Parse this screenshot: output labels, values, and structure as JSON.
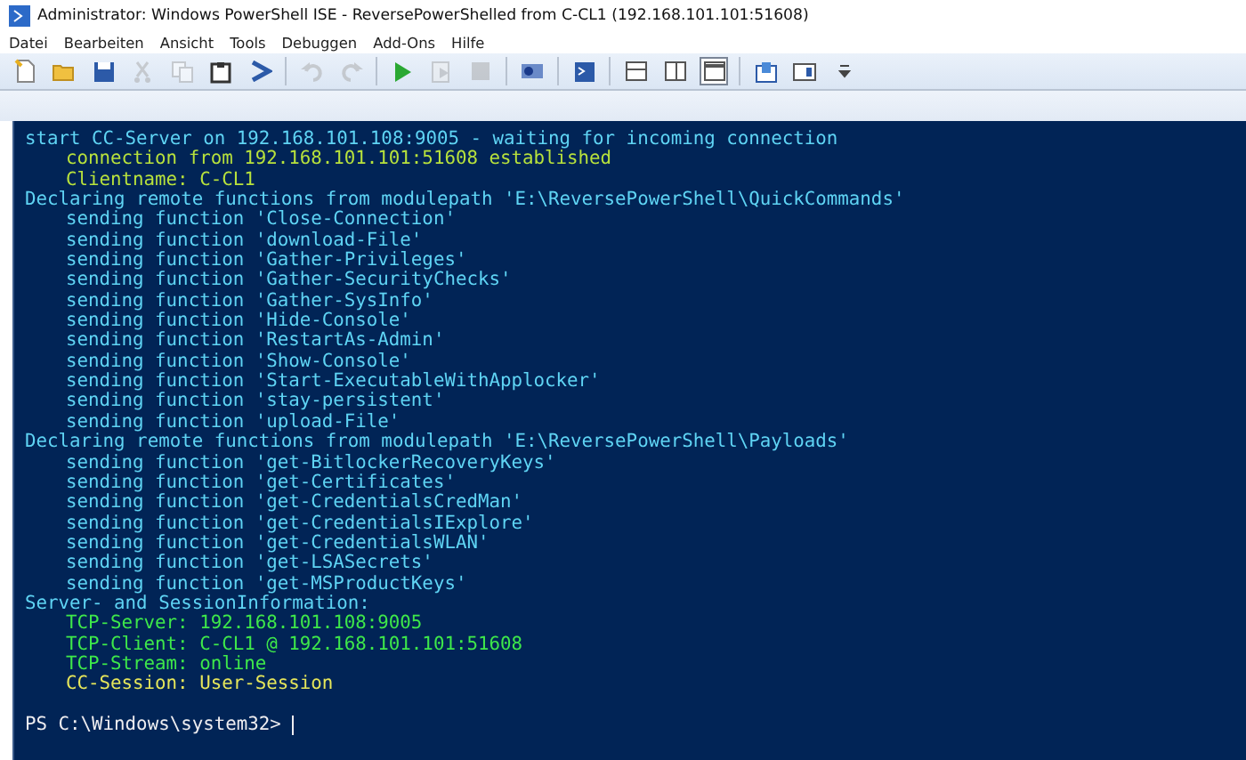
{
  "window": {
    "title": "Administrator: Windows PowerShell ISE - ReversePowerShelled from C-CL1 (192.168.101.101:51608)"
  },
  "menu": [
    "Datei",
    "Bearbeiten",
    "Ansicht",
    "Tools",
    "Debuggen",
    "Add-Ons",
    "Hilfe"
  ],
  "toolbar": [
    {
      "kind": "new",
      "disabled": false
    },
    {
      "kind": "open",
      "disabled": false
    },
    {
      "kind": "save",
      "disabled": false
    },
    {
      "kind": "cut",
      "disabled": true
    },
    {
      "kind": "copy",
      "disabled": true
    },
    {
      "kind": "paste",
      "disabled": false
    },
    {
      "kind": "prompt",
      "disabled": false
    },
    {
      "kind": "separator"
    },
    {
      "kind": "undo",
      "disabled": true
    },
    {
      "kind": "redo",
      "disabled": true
    },
    {
      "kind": "separator"
    },
    {
      "kind": "run",
      "disabled": false
    },
    {
      "kind": "run-selection",
      "disabled": true
    },
    {
      "kind": "stop",
      "disabled": true
    },
    {
      "kind": "separator"
    },
    {
      "kind": "remote",
      "disabled": false
    },
    {
      "kind": "separator"
    },
    {
      "kind": "console",
      "disabled": false
    },
    {
      "kind": "separator"
    },
    {
      "kind": "pane-top",
      "disabled": false,
      "selected": false
    },
    {
      "kind": "pane-right",
      "disabled": false,
      "selected": false
    },
    {
      "kind": "pane-max",
      "disabled": false,
      "selected": true
    },
    {
      "kind": "separator"
    },
    {
      "kind": "script-pane",
      "disabled": false
    },
    {
      "kind": "addon-pane",
      "disabled": false
    },
    {
      "kind": "overflow",
      "disabled": false
    }
  ],
  "console": {
    "lines": [
      {
        "kind": "top",
        "color": "#5fd4f4",
        "text": "start CC-Server on 192.168.101.108:9005 - waiting for incoming connection"
      },
      {
        "kind": "sub",
        "color": "#b8e23c",
        "text": "connection from 192.168.101.101:51608 established"
      },
      {
        "kind": "sub",
        "color": "#b8e23c",
        "text": "Clientname: C-CL1"
      },
      {
        "kind": "top",
        "color": "#5fd4f4",
        "text": "Declaring remote functions from modulepath 'E:\\ReversePowerShell\\QuickCommands'"
      },
      {
        "kind": "sub",
        "color": "#5fd4f4",
        "text": "sending function 'Close-Connection'"
      },
      {
        "kind": "sub",
        "color": "#5fd4f4",
        "text": "sending function 'download-File'"
      },
      {
        "kind": "sub",
        "color": "#5fd4f4",
        "text": "sending function 'Gather-Privileges'"
      },
      {
        "kind": "sub",
        "color": "#5fd4f4",
        "text": "sending function 'Gather-SecurityChecks'"
      },
      {
        "kind": "sub",
        "color": "#5fd4f4",
        "text": "sending function 'Gather-SysInfo'"
      },
      {
        "kind": "sub",
        "color": "#5fd4f4",
        "text": "sending function 'Hide-Console'"
      },
      {
        "kind": "sub",
        "color": "#5fd4f4",
        "text": "sending function 'RestartAs-Admin'"
      },
      {
        "kind": "sub",
        "color": "#5fd4f4",
        "text": "sending function 'Show-Console'"
      },
      {
        "kind": "sub",
        "color": "#5fd4f4",
        "text": "sending function 'Start-ExecutableWithApplocker'"
      },
      {
        "kind": "sub",
        "color": "#5fd4f4",
        "text": "sending function 'stay-persistent'"
      },
      {
        "kind": "sub",
        "color": "#5fd4f4",
        "text": "sending function 'upload-File'"
      },
      {
        "kind": "top",
        "color": "#5fd4f4",
        "text": "Declaring remote functions from modulepath 'E:\\ReversePowerShell\\Payloads'"
      },
      {
        "kind": "sub",
        "color": "#5fd4f4",
        "text": "sending function 'get-BitlockerRecoveryKeys'"
      },
      {
        "kind": "sub",
        "color": "#5fd4f4",
        "text": "sending function 'get-Certificates'"
      },
      {
        "kind": "sub",
        "color": "#5fd4f4",
        "text": "sending function 'get-CredentialsCredMan'"
      },
      {
        "kind": "sub",
        "color": "#5fd4f4",
        "text": "sending function 'get-CredentialsIExplore'"
      },
      {
        "kind": "sub",
        "color": "#5fd4f4",
        "text": "sending function 'get-CredentialsWLAN'"
      },
      {
        "kind": "sub",
        "color": "#5fd4f4",
        "text": "sending function 'get-LSASecrets'"
      },
      {
        "kind": "sub",
        "color": "#5fd4f4",
        "text": "sending function 'get-MSProductKeys'"
      },
      {
        "kind": "top",
        "color": "#5fd4f4",
        "text": "Server- and SessionInformation:"
      },
      {
        "kind": "sub",
        "color": "#3ee84a",
        "text": "TCP-Server: 192.168.101.108:9005"
      },
      {
        "kind": "sub",
        "color": "#3ee84a",
        "text": "TCP-Client: C-CL1 @ 192.168.101.101:51608"
      },
      {
        "kind": "sub",
        "color": "#3ee84a",
        "text": "TCP-Stream: online"
      },
      {
        "kind": "sub",
        "color": "#e6e65a",
        "text": "CC-Session: User-Session"
      }
    ],
    "prompt": "PS C:\\Windows\\system32>"
  }
}
